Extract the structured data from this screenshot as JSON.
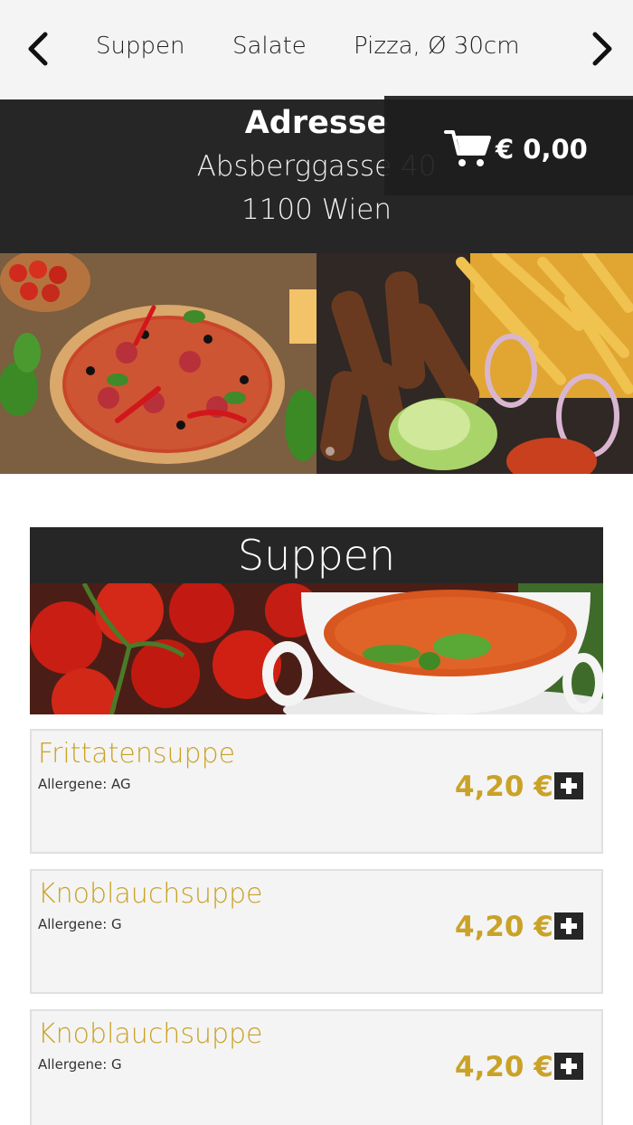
{
  "nav": {
    "prev_icon": "chevron-left-icon",
    "next_icon": "chevron-right-icon",
    "categories": [
      "Suppen",
      "Salate",
      "Pizza, Ø 30cm"
    ]
  },
  "address": {
    "title": "Adresse",
    "line1": "Absberggasse 40",
    "line2": "1100 Wien"
  },
  "cart": {
    "icon": "shopping-cart-icon",
    "total": "€ 0,00"
  },
  "section": {
    "title": "Suppen",
    "items": [
      {
        "name": "Frittatensuppe",
        "allergens": "Allergene: AG",
        "price": "4,20 €"
      },
      {
        "name": "Knoblauchsuppe",
        "allergens": "Allergene: G",
        "price": "4,20 €"
      },
      {
        "name": "Knoblauchsuppe",
        "allergens": "Allergene: G",
        "price": "4,20 €"
      }
    ]
  },
  "colors": {
    "accent": "#c9a227",
    "dark": "#262626",
    "item_bg": "#f4f4f4"
  }
}
